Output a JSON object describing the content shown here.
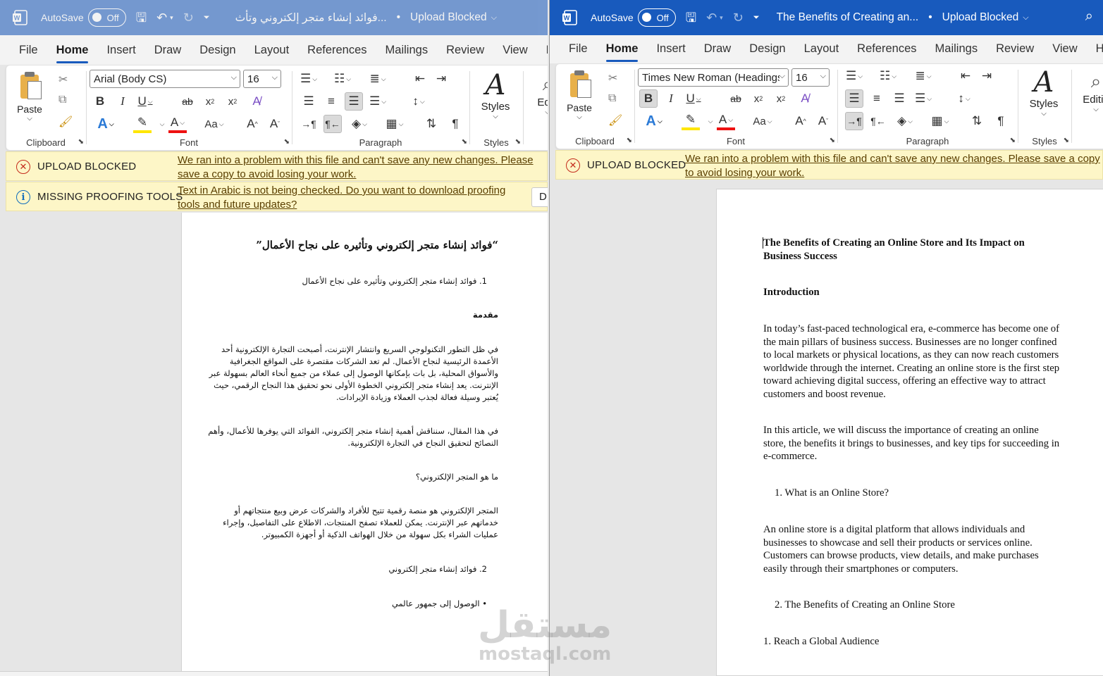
{
  "colors": {
    "title_bar": "#185abd",
    "notification_bg": "#fdf6c7",
    "error": "#c42b1c",
    "info": "#0f6cbd",
    "font_color_red": "#e11",
    "highlight_yellow": "#ffe600"
  },
  "icons": {
    "word": "word-icon",
    "save": "save-icon",
    "undo": "undo-icon",
    "redo": "redo-icon",
    "search": "search-icon"
  },
  "left": {
    "autosave_label": "AutoSave",
    "autosave_state": "Off",
    "doc_title": "فوائد إنشاء متجر إلكتروني وتأث...",
    "title_sep": "•",
    "upload_status": "Upload Blocked",
    "tabs": [
      "File",
      "Home",
      "Insert",
      "Draw",
      "Design",
      "Layout",
      "References",
      "Mailings",
      "Review",
      "View",
      "H"
    ],
    "clipboard": {
      "paste_label": "Paste",
      "group_label": "Clipboard"
    },
    "font": {
      "name": "Arial (Body CS)",
      "size": "16",
      "group_label": "Font"
    },
    "paragraph": {
      "group_label": "Paragraph"
    },
    "styles": {
      "label": "Styles",
      "group_label": "Styles"
    },
    "editing": {
      "label": "Editi"
    },
    "notifications": [
      {
        "title": "UPLOAD BLOCKED",
        "message": "We ran into a problem with this file and can't save any new changes. Please save a copy to avoid losing your work."
      },
      {
        "title": "MISSING PROOFING TOOLS",
        "message": "Text in Arabic is not being checked. Do you want to download proofing tools and future updates?",
        "button": "D"
      }
    ],
    "document": {
      "title": "“فوائد إنشاء متجر إلكتروني وتأثيره على نجاح الأعمال”",
      "item1": "1.  فوائد إنشاء متجر إلكتروني وتأثيره على نجاح الأعمال",
      "intro_heading": "مقدمة",
      "p1": [
        "في ظل التطور التكنولوجي السريع وانتشار الإنترنت، أصبحت التجارة الإلكترونية أحد",
        "الأعمدة الرئيسية لنجاح الأعمال. لم تعد الشركات مقتصرة على المواقع الجغرافية",
        "والأسواق المحلية، بل بات بإمكانها الوصول إلى عملاء من جميع أنحاء العالم بسهولة عبر",
        "الإنترنت. يعد إنشاء متجر إلكتروني الخطوة الأولى نحو تحقيق هذا النجاح الرقمي، حيث",
        "يُعتبر وسيلة فعالة لجذب العملاء وزيادة الإيرادات."
      ],
      "p2": [
        "في هذا المقال، سنناقش أهمية إنشاء متجر إلكتروني، الفوائد التي يوفرها للأعمال، وأهم",
        "النصائح لتحقيق النجاح في التجارة الإلكترونية."
      ],
      "q1": "ما هو المتجر الإلكتروني؟",
      "p3": [
        "المتجر الإلكتروني هو منصة رقمية تتيح للأفراد والشركات عرض وبيع منتجاتهم أو",
        "خدماتهم عبر الإنترنت. يمكن للعملاء تصفح المنتجات، الاطلاع على التفاصيل، وإجراء",
        "عمليات الشراء بكل سهولة من خلال الهواتف الذكية أو أجهزة الكمبيوتر."
      ],
      "item2": "2.  فوائد إنشاء متجر إلكتروني",
      "bullet1": "•   الوصول إلى جمهور عالمي"
    }
  },
  "right": {
    "autosave_label": "AutoSave",
    "autosave_state": "Off",
    "doc_title": "The Benefits of Creating an...",
    "title_sep": "•",
    "upload_status": "Upload Blocked",
    "tabs": [
      "File",
      "Home",
      "Insert",
      "Draw",
      "Design",
      "Layout",
      "References",
      "Mailings",
      "Review",
      "View",
      "Hel"
    ],
    "clipboard": {
      "paste_label": "Paste",
      "group_label": "Clipboard"
    },
    "font": {
      "name": "Times New Roman (Headings",
      "size": "16",
      "group_label": "Font"
    },
    "paragraph": {
      "group_label": "Paragraph"
    },
    "styles": {
      "label": "Styles",
      "group_label": "Styles"
    },
    "editing": {
      "label": "Editin"
    },
    "notifications": [
      {
        "title": "UPLOAD BLOCKED",
        "message": "We ran into a problem with this file and can't save any new changes. Please save a copy to avoid losing your work."
      }
    ],
    "document": {
      "title": "The Benefits of Creating an Online Store and Its Impact on Business Success",
      "intro_heading": "Introduction",
      "p1": "In today’s fast-paced technological era, e-commerce has become one of the main pillars of business success. Businesses are no longer confined to local markets or physical locations, as they can now reach customers worldwide through the internet. Creating an online store is the first step toward achieving digital success, offering an effective way to attract customers and boost revenue.",
      "p2": "In this article, we will discuss the importance of creating an online store, the benefits it brings to businesses, and key tips for succeeding in e-commerce.",
      "item1": "1.  What is an Online Store?",
      "p3": "An online store is a digital platform that allows individuals and businesses to showcase and sell their products or services online. Customers can browse products, view details, and make purchases easily through their smartphones or computers.",
      "item2": "2.  The Benefits of Creating an Online Store",
      "sub1": "1. Reach a Global Audience"
    }
  },
  "watermark": {
    "arabic": "مستقل",
    "latin": "mostaql.com"
  }
}
